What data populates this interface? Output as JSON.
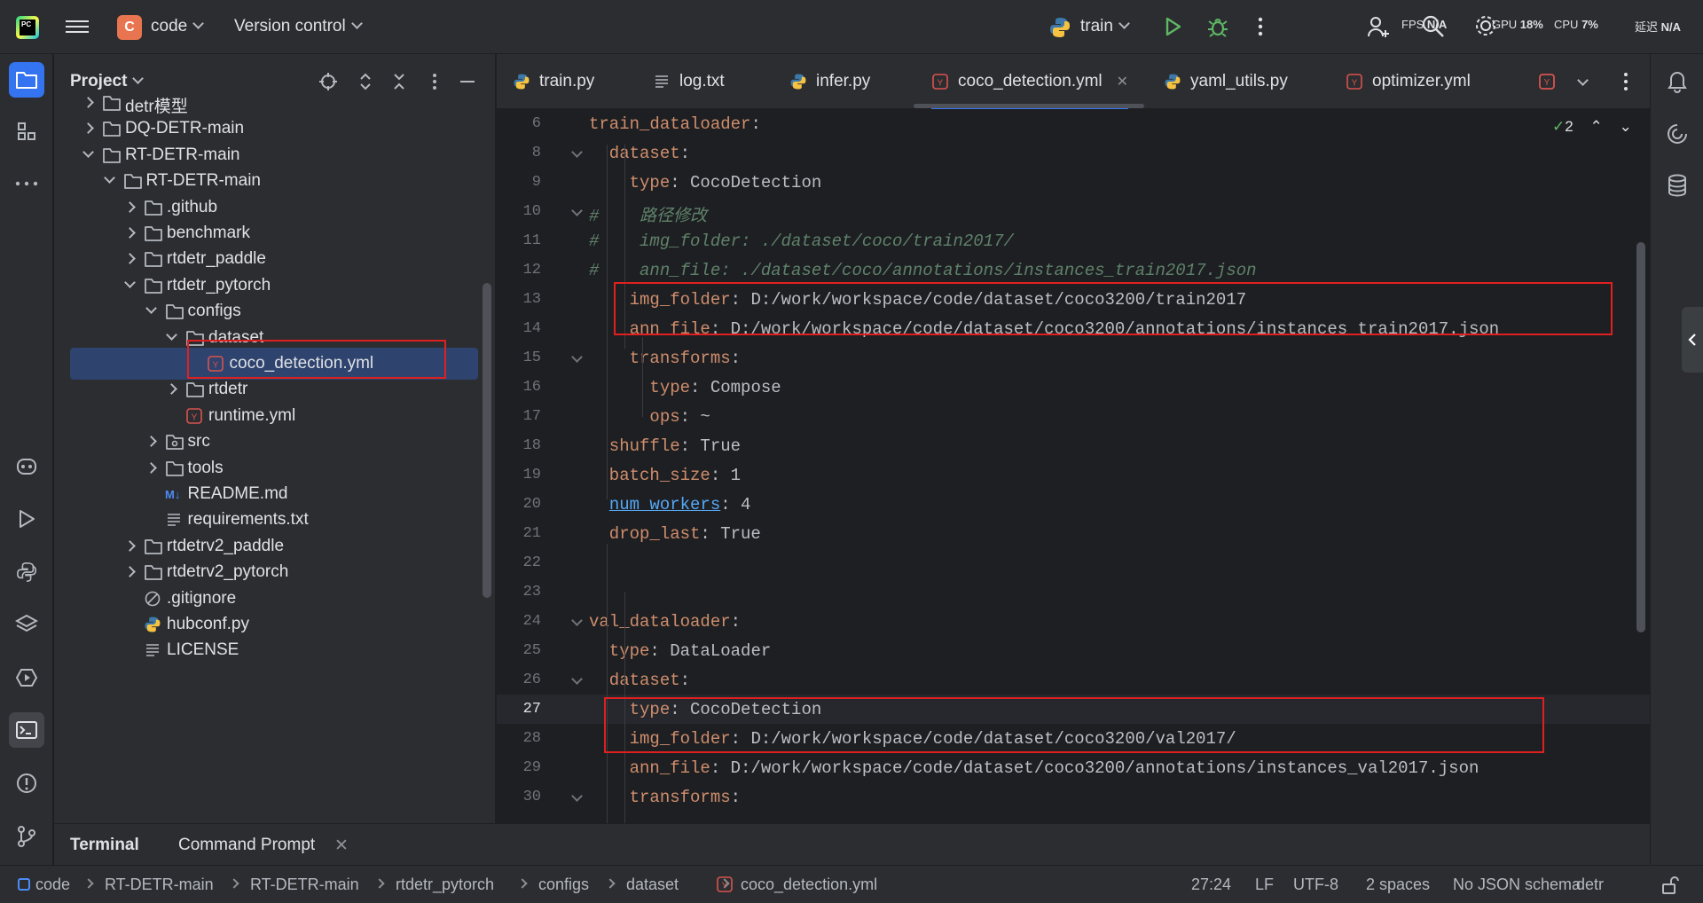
{
  "titlebar": {
    "project_badge": "C",
    "project_name": "code",
    "vcs": "Version control",
    "run_config": "train",
    "fps_label": "FPS",
    "fps_value": "N/A",
    "gpu_label": "GPU",
    "gpu_value": "18%",
    "cpu_label": "CPU",
    "cpu_value": "7%",
    "latency_label": "延迟",
    "latency_value": "N/A"
  },
  "project_panel": {
    "title": "Project",
    "tree": [
      {
        "label": "detr模型",
        "depth": 0,
        "kind": "folder",
        "arrow": "closed"
      },
      {
        "label": "DQ-DETR-main",
        "depth": 0,
        "kind": "folder",
        "arrow": "closed"
      },
      {
        "label": "RT-DETR-main",
        "depth": 0,
        "kind": "folder",
        "arrow": "open"
      },
      {
        "label": "RT-DETR-main",
        "depth": 1,
        "kind": "folder",
        "arrow": "open"
      },
      {
        "label": ".github",
        "depth": 2,
        "kind": "folder",
        "arrow": "closed"
      },
      {
        "label": "benchmark",
        "depth": 2,
        "kind": "folder",
        "arrow": "closed"
      },
      {
        "label": "rtdetr_paddle",
        "depth": 2,
        "kind": "folder",
        "arrow": "closed"
      },
      {
        "label": "rtdetr_pytorch",
        "depth": 2,
        "kind": "folder",
        "arrow": "open"
      },
      {
        "label": "configs",
        "depth": 3,
        "kind": "folder",
        "arrow": "open"
      },
      {
        "label": "dataset",
        "depth": 4,
        "kind": "folder",
        "arrow": "open"
      },
      {
        "label": "coco_detection.yml",
        "depth": 5,
        "kind": "yaml",
        "arrow": "none",
        "selected": true
      },
      {
        "label": "rtdetr",
        "depth": 4,
        "kind": "folder",
        "arrow": "closed"
      },
      {
        "label": "runtime.yml",
        "depth": 4,
        "kind": "yaml",
        "arrow": "none"
      },
      {
        "label": "src",
        "depth": 3,
        "kind": "pkg",
        "arrow": "closed"
      },
      {
        "label": "tools",
        "depth": 3,
        "kind": "folder",
        "arrow": "closed"
      },
      {
        "label": "README.md",
        "depth": 3,
        "kind": "md",
        "arrow": "none"
      },
      {
        "label": "requirements.txt",
        "depth": 3,
        "kind": "txt",
        "arrow": "none"
      },
      {
        "label": "rtdetrv2_paddle",
        "depth": 2,
        "kind": "folder",
        "arrow": "closed"
      },
      {
        "label": "rtdetrv2_pytorch",
        "depth": 2,
        "kind": "folder",
        "arrow": "closed"
      },
      {
        "label": ".gitignore",
        "depth": 2,
        "kind": "ignore",
        "arrow": "none"
      },
      {
        "label": "hubconf.py",
        "depth": 2,
        "kind": "py",
        "arrow": "none"
      },
      {
        "label": "LICENSE",
        "depth": 2,
        "kind": "txt",
        "arrow": "none"
      }
    ]
  },
  "tabs": [
    {
      "label": "train.py",
      "kind": "py"
    },
    {
      "label": "log.txt",
      "kind": "txt"
    },
    {
      "label": "infer.py",
      "kind": "py"
    },
    {
      "label": "coco_detection.yml",
      "kind": "yaml",
      "active": true
    },
    {
      "label": "yaml_utils.py",
      "kind": "py"
    },
    {
      "label": "optimizer.yml",
      "kind": "yaml"
    }
  ],
  "editor": {
    "inspection_count": "2",
    "lines": [
      {
        "n": "6",
        "parts": [
          {
            "t": "train_dataloader",
            "c": "k"
          },
          {
            "t": ":",
            "c": "v"
          }
        ]
      },
      {
        "n": "8",
        "parts": [
          {
            "t": "  dataset",
            "c": "k"
          },
          {
            "t": ":",
            "c": "v"
          }
        ]
      },
      {
        "n": "9",
        "parts": [
          {
            "t": "    type",
            "c": "k"
          },
          {
            "t": ": CocoDetection",
            "c": "v"
          }
        ]
      },
      {
        "n": "10",
        "parts": [
          {
            "t": "#    路径修改",
            "c": "c"
          }
        ]
      },
      {
        "n": "11",
        "parts": [
          {
            "t": "#    img_folder: ./dataset/coco/train2017/",
            "c": "c"
          }
        ]
      },
      {
        "n": "12",
        "parts": [
          {
            "t": "#    ann_file: ./dataset/coco/annotations/instances_train2017.json",
            "c": "c"
          }
        ]
      },
      {
        "n": "13",
        "parts": [
          {
            "t": "    img_folder",
            "c": "k"
          },
          {
            "t": ": D:/work/workspace/code/dataset/coco3200/train2017",
            "c": "v"
          }
        ]
      },
      {
        "n": "14",
        "parts": [
          {
            "t": "    ann_file",
            "c": "k"
          },
          {
            "t": ": D:/work/workspace/code/dataset/coco3200/annotations/instances_train2017.json",
            "c": "v"
          }
        ]
      },
      {
        "n": "15",
        "parts": [
          {
            "t": "    transforms",
            "c": "k"
          },
          {
            "t": ":",
            "c": "v"
          }
        ]
      },
      {
        "n": "16",
        "parts": [
          {
            "t": "      type",
            "c": "k"
          },
          {
            "t": ": Compose",
            "c": "v"
          }
        ]
      },
      {
        "n": "17",
        "parts": [
          {
            "t": "      ops",
            "c": "k"
          },
          {
            "t": ": ~",
            "c": "v"
          }
        ]
      },
      {
        "n": "18",
        "parts": [
          {
            "t": "  shuffle",
            "c": "k"
          },
          {
            "t": ": True",
            "c": "v"
          }
        ]
      },
      {
        "n": "19",
        "parts": [
          {
            "t": "  batch_size",
            "c": "k"
          },
          {
            "t": ": 1",
            "c": "v"
          }
        ]
      },
      {
        "n": "20",
        "parts": [
          {
            "t": "  ",
            "c": "v"
          },
          {
            "t": "num_workers",
            "c": "kl"
          },
          {
            "t": ": 4",
            "c": "v"
          }
        ]
      },
      {
        "n": "21",
        "parts": [
          {
            "t": "  drop_last",
            "c": "k"
          },
          {
            "t": ": True",
            "c": "v"
          }
        ]
      },
      {
        "n": "22",
        "parts": []
      },
      {
        "n": "23",
        "parts": []
      },
      {
        "n": "24",
        "parts": [
          {
            "t": "val_dataloader",
            "c": "k"
          },
          {
            "t": ":",
            "c": "v"
          }
        ]
      },
      {
        "n": "25",
        "parts": [
          {
            "t": "  type",
            "c": "k"
          },
          {
            "t": ": DataLoader",
            "c": "v"
          }
        ]
      },
      {
        "n": "26",
        "parts": [
          {
            "t": "  dataset",
            "c": "k"
          },
          {
            "t": ":",
            "c": "v"
          }
        ]
      },
      {
        "n": "27",
        "parts": [
          {
            "t": "    type",
            "c": "k"
          },
          {
            "t": ": CocoDetection",
            "c": "v"
          }
        ],
        "current": true
      },
      {
        "n": "28",
        "parts": [
          {
            "t": "    img_folder",
            "c": "k"
          },
          {
            "t": ": D:/work/workspace/code/dataset/coco3200/val2017/",
            "c": "v"
          }
        ]
      },
      {
        "n": "29",
        "parts": [
          {
            "t": "    ann_file",
            "c": "k"
          },
          {
            "t": ": D:/work/workspace/code/dataset/coco3200/annotations/instances_val2017.json",
            "c": "v"
          }
        ]
      },
      {
        "n": "30",
        "parts": [
          {
            "t": "    transforms",
            "c": "k"
          },
          {
            "t": ":",
            "c": "v"
          }
        ]
      }
    ]
  },
  "bottom_tabs": {
    "terminal": "Terminal",
    "command_prompt": "Command Prompt"
  },
  "statusbar": {
    "breadcrumbs": [
      "code",
      "RT-DETR-main",
      "RT-DETR-main",
      "rtdetr_pytorch",
      "configs",
      "dataset",
      "coco_detection.yml"
    ],
    "position": "27:24",
    "line_sep": "LF",
    "encoding": "UTF-8",
    "indent": "2 spaces",
    "schema": "No JSON schema",
    "interpreter": "detr"
  },
  "colors": {
    "accent": "#3574f0",
    "highlight_box": "#e02020",
    "keyword": "#cf8e6d",
    "comment": "#5f826b"
  }
}
